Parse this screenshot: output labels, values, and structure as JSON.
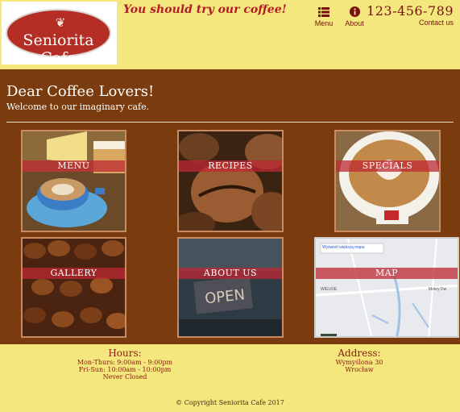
{
  "header": {
    "logo_text": "Seniorita Cafe",
    "tagline": "You should try our coffee!",
    "nav": [
      {
        "label": "Menu",
        "icon": "list-icon"
      },
      {
        "label": "About",
        "icon": "info-icon"
      }
    ],
    "phone": "123-456-789",
    "contact_label": "Contact us"
  },
  "welcome": {
    "title": "Dear Coffee Lovers!",
    "subtitle": "Welcome to our imaginary cafe."
  },
  "tiles": [
    {
      "label": "MENU"
    },
    {
      "label": "RECIPES"
    },
    {
      "label": "SPECIALS"
    },
    {
      "label": "GALLERY"
    },
    {
      "label": "ABOUT US"
    },
    {
      "label": "MAP"
    }
  ],
  "map": {
    "button_label": "Wyświetl większą mapę",
    "place_left": "WIELKIE",
    "place_right": "Mokry Dw"
  },
  "footer": {
    "hours_title": "Hours:",
    "hours_lines": [
      "Mon-Thurs: 9:00am - 9:00pm",
      "Fri-Sun: 10:00am - 10:00pm",
      "Never Closed"
    ],
    "address_title": "Address:",
    "address_lines": [
      "Wymyślona 30",
      "Wrocław"
    ],
    "copyright": "© Copyright Seniorita Cafe 2017"
  },
  "colors": {
    "brown": "#7a3b0f",
    "yellow": "#f4e77d",
    "red": "#b52e26"
  }
}
